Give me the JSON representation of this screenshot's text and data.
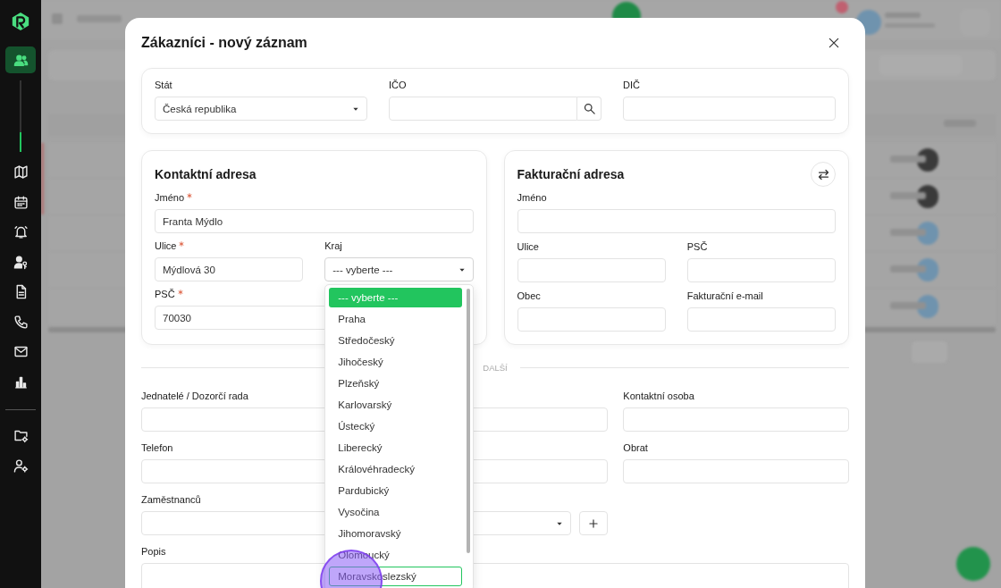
{
  "sidebar": {
    "items": [
      {
        "kind": "users",
        "selected": true
      },
      {
        "kind": "map",
        "selected": false
      },
      {
        "kind": "calendar",
        "selected": false
      },
      {
        "kind": "alarm",
        "selected": false
      },
      {
        "kind": "user-key",
        "selected": false
      },
      {
        "kind": "document",
        "selected": false
      },
      {
        "kind": "phone",
        "selected": false
      },
      {
        "kind": "mail",
        "selected": false
      },
      {
        "kind": "chart",
        "selected": false
      }
    ],
    "tools": [
      {
        "kind": "folder-settings",
        "selected": false
      },
      {
        "kind": "user-settings",
        "selected": false
      }
    ]
  },
  "modal": {
    "title": "Zákazníci - nový záznam",
    "general": {
      "rows": [
        [
          {
            "label": "Stát",
            "kind": "select",
            "value": "Česká republika",
            "required": false
          },
          {
            "label": "IČO",
            "kind": "search",
            "required": false
          },
          {
            "label": "DIČ",
            "kind": "text",
            "required": false
          }
        ]
      ]
    },
    "contact_address": {
      "title": "Kontaktní adresa",
      "rows": [
        [
          {
            "label": "Jméno",
            "kind": "text",
            "value": "Franta Mýdlo",
            "required": true
          }
        ],
        [
          {
            "label": "Ulice",
            "kind": "text",
            "value": "Mýdlová 30",
            "required": true
          },
          {
            "label": "Kraj",
            "kind": "select",
            "value": "--- vyberte ---",
            "required": false,
            "open": true
          }
        ],
        [
          {
            "label": "PSČ",
            "kind": "text",
            "value": "70030",
            "required": true
          }
        ]
      ]
    },
    "billing_address": {
      "title": "Fakturační adresa",
      "rows": [
        [
          {
            "label": "Jméno",
            "kind": "text",
            "required": false
          }
        ],
        [
          {
            "label": "Ulice",
            "kind": "text",
            "required": false
          },
          {
            "label": "PSČ",
            "kind": "text",
            "required": false
          }
        ],
        [
          {
            "label": "Obec",
            "kind": "text",
            "required": false
          },
          {
            "label": "Fakturační e-mail",
            "kind": "text",
            "required": false
          }
        ]
      ]
    },
    "section_divider": "DALŠÍ",
    "other": {
      "rows": [
        [
          {
            "label": "Jednatelé / Dozorčí rada",
            "kind": "text",
            "required": false
          },
          {
            "label": "Kontaktní osoba",
            "kind": "text",
            "required": false
          }
        ],
        [
          {
            "label": "Telefon",
            "kind": "text",
            "required": false
          },
          {
            "label": "Obrat",
            "kind": "text",
            "required": false
          }
        ],
        [
          {
            "label": "Zaměstnanců",
            "kind": "select-add",
            "required": false
          }
        ],
        [
          {
            "label": "Popis",
            "kind": "textarea",
            "required": false
          }
        ]
      ]
    },
    "region_dropdown": {
      "options": [
        {
          "label": "--- vyberte ---",
          "selected": true,
          "focused": false
        },
        {
          "label": "Praha",
          "selected": false,
          "focused": false
        },
        {
          "label": "Středočeský",
          "selected": false,
          "focused": false
        },
        {
          "label": "Jihočeský",
          "selected": false,
          "focused": false
        },
        {
          "label": "Plzeňský",
          "selected": false,
          "focused": false
        },
        {
          "label": "Karlovarský",
          "selected": false,
          "focused": false
        },
        {
          "label": "Ústecký",
          "selected": false,
          "focused": false
        },
        {
          "label": "Liberecký",
          "selected": false,
          "focused": false
        },
        {
          "label": "Královéhradecký",
          "selected": false,
          "focused": false
        },
        {
          "label": "Pardubický",
          "selected": false,
          "focused": false
        },
        {
          "label": "Vysočina",
          "selected": false,
          "focused": false
        },
        {
          "label": "Jihomoravský",
          "selected": false,
          "focused": false
        },
        {
          "label": "Olomoucký",
          "selected": false,
          "focused": false
        },
        {
          "label": "Moravskoslezský",
          "selected": false,
          "focused": true
        }
      ]
    }
  },
  "click_indicator": true
}
